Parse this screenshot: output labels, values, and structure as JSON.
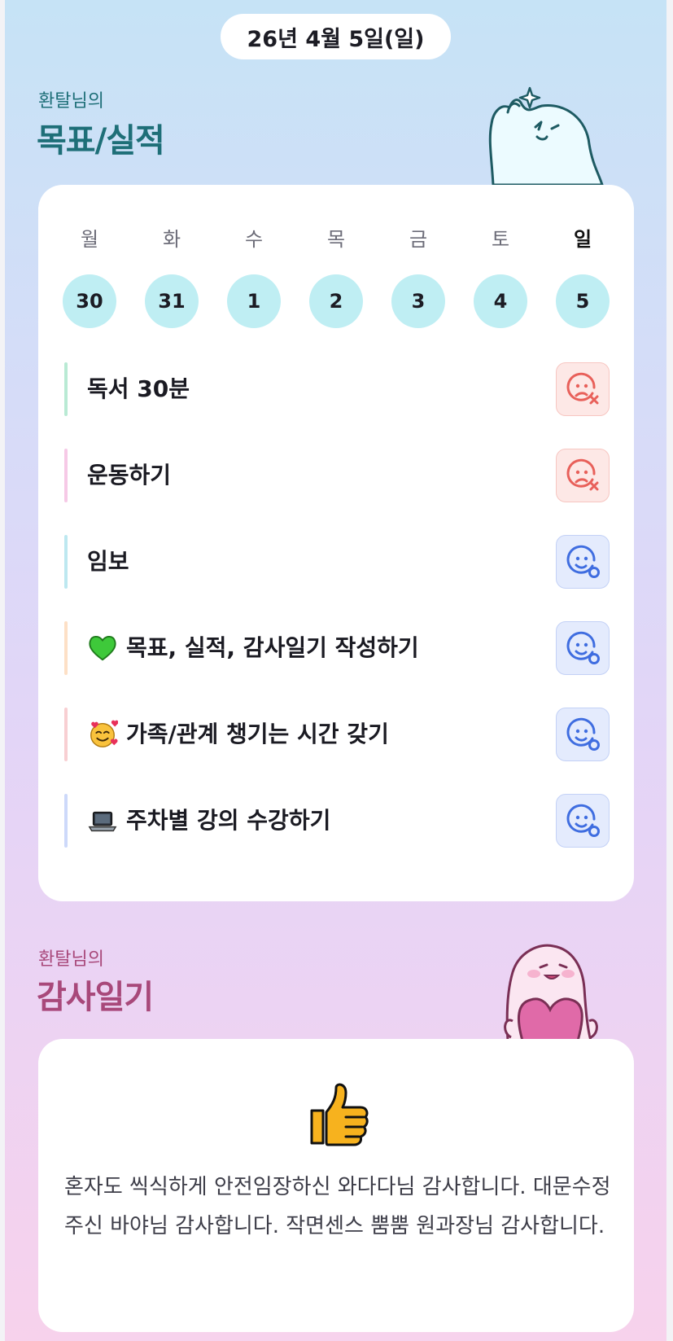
{
  "header": {
    "date": "26년 4월 5일(일)"
  },
  "goals_section": {
    "owner": "환탈님의",
    "title": "목표/실적"
  },
  "week": [
    {
      "day": "월",
      "date": "30"
    },
    {
      "day": "화",
      "date": "31"
    },
    {
      "day": "수",
      "date": "1"
    },
    {
      "day": "목",
      "date": "2"
    },
    {
      "day": "금",
      "date": "3"
    },
    {
      "day": "토",
      "date": "4"
    },
    {
      "day": "일",
      "date": "5",
      "today": true
    }
  ],
  "goals": [
    {
      "text": "독서 30분",
      "icon": "",
      "bar_color": "#b9ead4",
      "status": "fail"
    },
    {
      "text": "운동하기",
      "icon": "",
      "bar_color": "#f6c9e6",
      "status": "fail"
    },
    {
      "text": "임보",
      "icon": "",
      "bar_color": "#bde8f0",
      "status": "done"
    },
    {
      "text": "목표, 실적, 감사일기 작성하기",
      "icon": "green-heart-icon",
      "bar_color": "#fde0c6",
      "status": "done"
    },
    {
      "text": "가족/관계 챙기는 시간 갖기",
      "icon": "smiling-face-with-hearts-icon",
      "bar_color": "#f8cfd2",
      "status": "done"
    },
    {
      "text": "주차별 강의 수강하기",
      "icon": "laptop-icon",
      "bar_color": "#cdd9fa",
      "status": "done"
    }
  ],
  "gratitude_section": {
    "owner": "환탈님의",
    "title": "감사일기"
  },
  "gratitude": {
    "icon": "thumbs-up-icon",
    "text": "혼자도 씩식하게 안전임장하신 와다다님 감사합니다. 대문수정 주신 바야님 감사합니다. 작면센스 뿜뿜 원과장님 감사합니다."
  },
  "colors": {
    "accent_teal": "#1e6f78",
    "accent_plum": "#a8487a",
    "fail_icon": "#e8605a",
    "done_icon": "#3f6de0",
    "date_circle": "#bfeef3"
  }
}
